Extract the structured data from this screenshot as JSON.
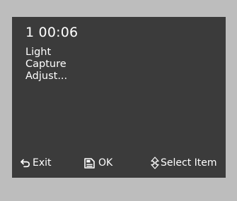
{
  "status": {
    "clock": "1 00:06"
  },
  "menu": {
    "items": [
      {
        "label": "Light"
      },
      {
        "label": "Capture"
      },
      {
        "label": "Adjust..."
      }
    ]
  },
  "softkeys": {
    "exit": {
      "label": "Exit",
      "icon": "back-arrow-icon"
    },
    "ok": {
      "label": "OK",
      "icon": "document-icon"
    },
    "select": {
      "label": "Select Item",
      "icon": "up-down-arrows-icon"
    }
  },
  "colors": {
    "background": "#bdbdbd",
    "screen": "#3b3b3b",
    "text": "#ffffff"
  }
}
